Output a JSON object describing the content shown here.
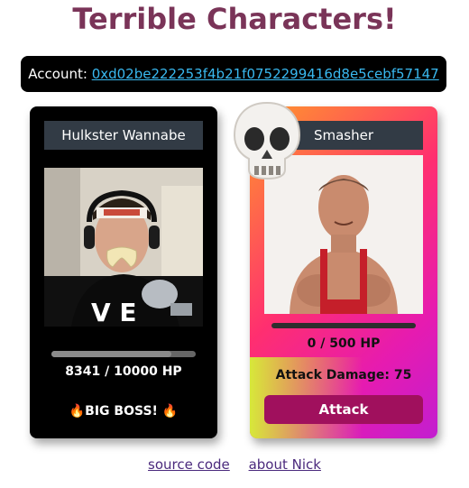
{
  "page": {
    "title": "Terrible Characters!"
  },
  "account": {
    "label": "Account:",
    "address": "0xd02be222253f4b21f0752299416d8e5cebf57147"
  },
  "boss": {
    "name": "Hulkster Wannabe",
    "hp_current": 8341,
    "hp_max": 10000,
    "hp_text": "8341 / 10000 HP",
    "hp_fraction": 0.834,
    "badge": "🔥BIG BOSS! 🔥"
  },
  "player": {
    "name": "Smasher",
    "hp_current": 0,
    "hp_max": 500,
    "hp_text": "0 / 500 HP",
    "hp_fraction": 0.0,
    "attack_damage_text": "Attack Damage: 75",
    "attack_button": "Attack",
    "status_icon": "skull-icon"
  },
  "footer": {
    "links": [
      "source code",
      "about Nick"
    ]
  },
  "colors": {
    "title": "#7a3458",
    "link": "#39b9f0",
    "attack_button": "#a0105d"
  }
}
